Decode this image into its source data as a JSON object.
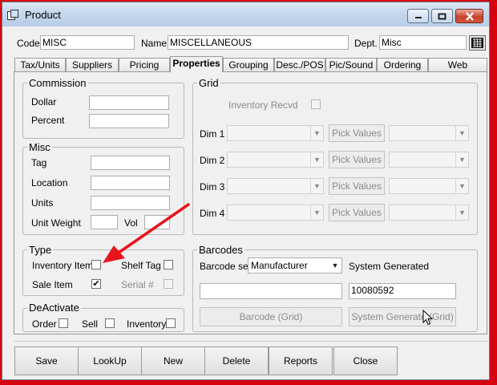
{
  "window": {
    "title": "Product",
    "controls": {
      "minimize_icon": "minimize-icon",
      "maximize_icon": "maximize-icon",
      "close_icon": "close-icon"
    }
  },
  "header": {
    "code_label": "Code",
    "code_value": "MISC",
    "name_label": "Name",
    "name_value": "MISCELLANEOUS",
    "dept_label": "Dept.",
    "dept_value": "Misc",
    "dept_lookup_icon": "lookup-grid-icon"
  },
  "tabs": [
    {
      "label": "Tax/Units"
    },
    {
      "label": "Suppliers"
    },
    {
      "label": "Pricing"
    },
    {
      "label": "Properties"
    },
    {
      "label": "Grouping"
    },
    {
      "label": "Desc./POS"
    },
    {
      "label": "Pic/Sound"
    },
    {
      "label": "Ordering"
    },
    {
      "label": "Web"
    }
  ],
  "active_tab": "Properties",
  "commission": {
    "title": "Commission",
    "dollar_label": "Dollar",
    "percent_label": "Percent"
  },
  "misc": {
    "title": "Misc",
    "tag_label": "Tag",
    "location_label": "Location",
    "units_label": "Units",
    "unit_weight_label": "Unit Weight",
    "vol_label": "Vol"
  },
  "type": {
    "title": "Type",
    "inventory_item_label": "Inventory Item",
    "shelf_tag_label": "Shelf Tag",
    "sale_item_label": "Sale Item",
    "serial_label": "Serial #",
    "check_mark": "✔"
  },
  "deactivate": {
    "title": "DeActivate",
    "order_label": "Order",
    "sell_label": "Sell",
    "inventory_label": "Inventory"
  },
  "grid": {
    "title": "Grid",
    "inventory_recvd_label": "Inventory Recvd",
    "dims": [
      {
        "label": "Dim 1",
        "button": "Pick Values"
      },
      {
        "label": "Dim 2",
        "button": "Pick Values"
      },
      {
        "label": "Dim 3",
        "button": "Pick Values"
      },
      {
        "label": "Dim 4",
        "button": "Pick Values"
      }
    ],
    "arrow": "▼"
  },
  "barcodes": {
    "title": "Barcodes",
    "set_label": "Barcode set",
    "set_value": "Manufacturer",
    "system_generated_label": "System Generated",
    "barcode_value": "",
    "system_value": "10080592",
    "barcode_grid_button": "Barcode (Grid)",
    "system_grid_button": "System Generate (Grid)"
  },
  "footer": {
    "save": "Save",
    "lookup": "LookUp",
    "new": "New",
    "delete": "Delete",
    "reports": "Reports",
    "close": "Close"
  },
  "colors": {
    "annotation_arrow": "#e8141c",
    "background_frame": "#d6000f"
  }
}
